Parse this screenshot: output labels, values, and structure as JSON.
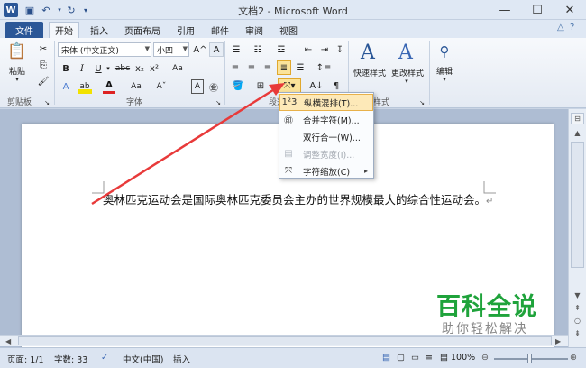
{
  "window": {
    "title": "文档2 - Microsoft Word",
    "minimize_icon": "minimize-icon",
    "maximize_icon": "maximize-icon",
    "close_icon": "close-icon",
    "word_logo": "W"
  },
  "quick_access": {
    "save_icon": "save-icon",
    "undo_icon": "undo-icon",
    "redo_icon": "redo-icon",
    "customize_icon": "customize-icon"
  },
  "tabs": [
    {
      "label": "文件"
    },
    {
      "label": "开始"
    },
    {
      "label": "插入"
    },
    {
      "label": "页面布局"
    },
    {
      "label": "引用"
    },
    {
      "label": "邮件"
    },
    {
      "label": "审阅"
    },
    {
      "label": "视图"
    }
  ],
  "ribbon": {
    "clipboard": {
      "paste_label": "粘贴",
      "group_label": "剪贴板"
    },
    "font": {
      "font_name": "宋体 (中文正文)",
      "font_size": "小四",
      "group_label": "字体",
      "bold": "B",
      "italic": "I",
      "underline": "U",
      "strikethrough": "abc",
      "subscript": "x₂",
      "superscript": "x²",
      "grow_font": "A^",
      "shrink_font": "Aˇ",
      "change_case": "Aa",
      "font_color": "A",
      "highlight": "ab",
      "char_border": "A",
      "phonetic": "文",
      "enclose": "㊎"
    },
    "paragraph": {
      "group_label": "段落"
    },
    "styles": {
      "quick_styles": "快速样式",
      "change_styles": "更改样式",
      "group_label": "样式"
    },
    "editing": {
      "label": "编辑"
    }
  },
  "dropdown_menu": {
    "items": [
      {
        "label": "纵横混排(T)...",
        "icon": "vertical-horizontal-icon",
        "highlighted": true,
        "disabled": false
      },
      {
        "label": "合并字符(M)...",
        "icon": "combine-characters-icon",
        "highlighted": false,
        "disabled": false
      },
      {
        "label": "双行合一(W)...",
        "icon": "two-lines-in-one-icon",
        "highlighted": false,
        "disabled": false
      },
      {
        "label": "调整宽度(I)...",
        "icon": "fit-text-icon",
        "highlighted": false,
        "disabled": true
      },
      {
        "label": "字符缩放(C)",
        "icon": "character-scale-icon",
        "highlighted": false,
        "disabled": false
      }
    ]
  },
  "document": {
    "text": "奥林匹克运动会是国际奥林匹克委员会主办的世界规模最大的综合性运动会。",
    "para_mark": "↵"
  },
  "status_bar": {
    "page": "页面: 1/1",
    "words": "字数: 33",
    "language": "中文(中国)",
    "mode": "插入",
    "zoom": "100%"
  },
  "watermark": {
    "main": "百科全说",
    "sub": "助你轻松解决"
  },
  "colors": {
    "accent": "#2b5797",
    "highlight": "#fbe39a",
    "arrow": "#e83a3a",
    "watermark": "#1fa33b"
  }
}
